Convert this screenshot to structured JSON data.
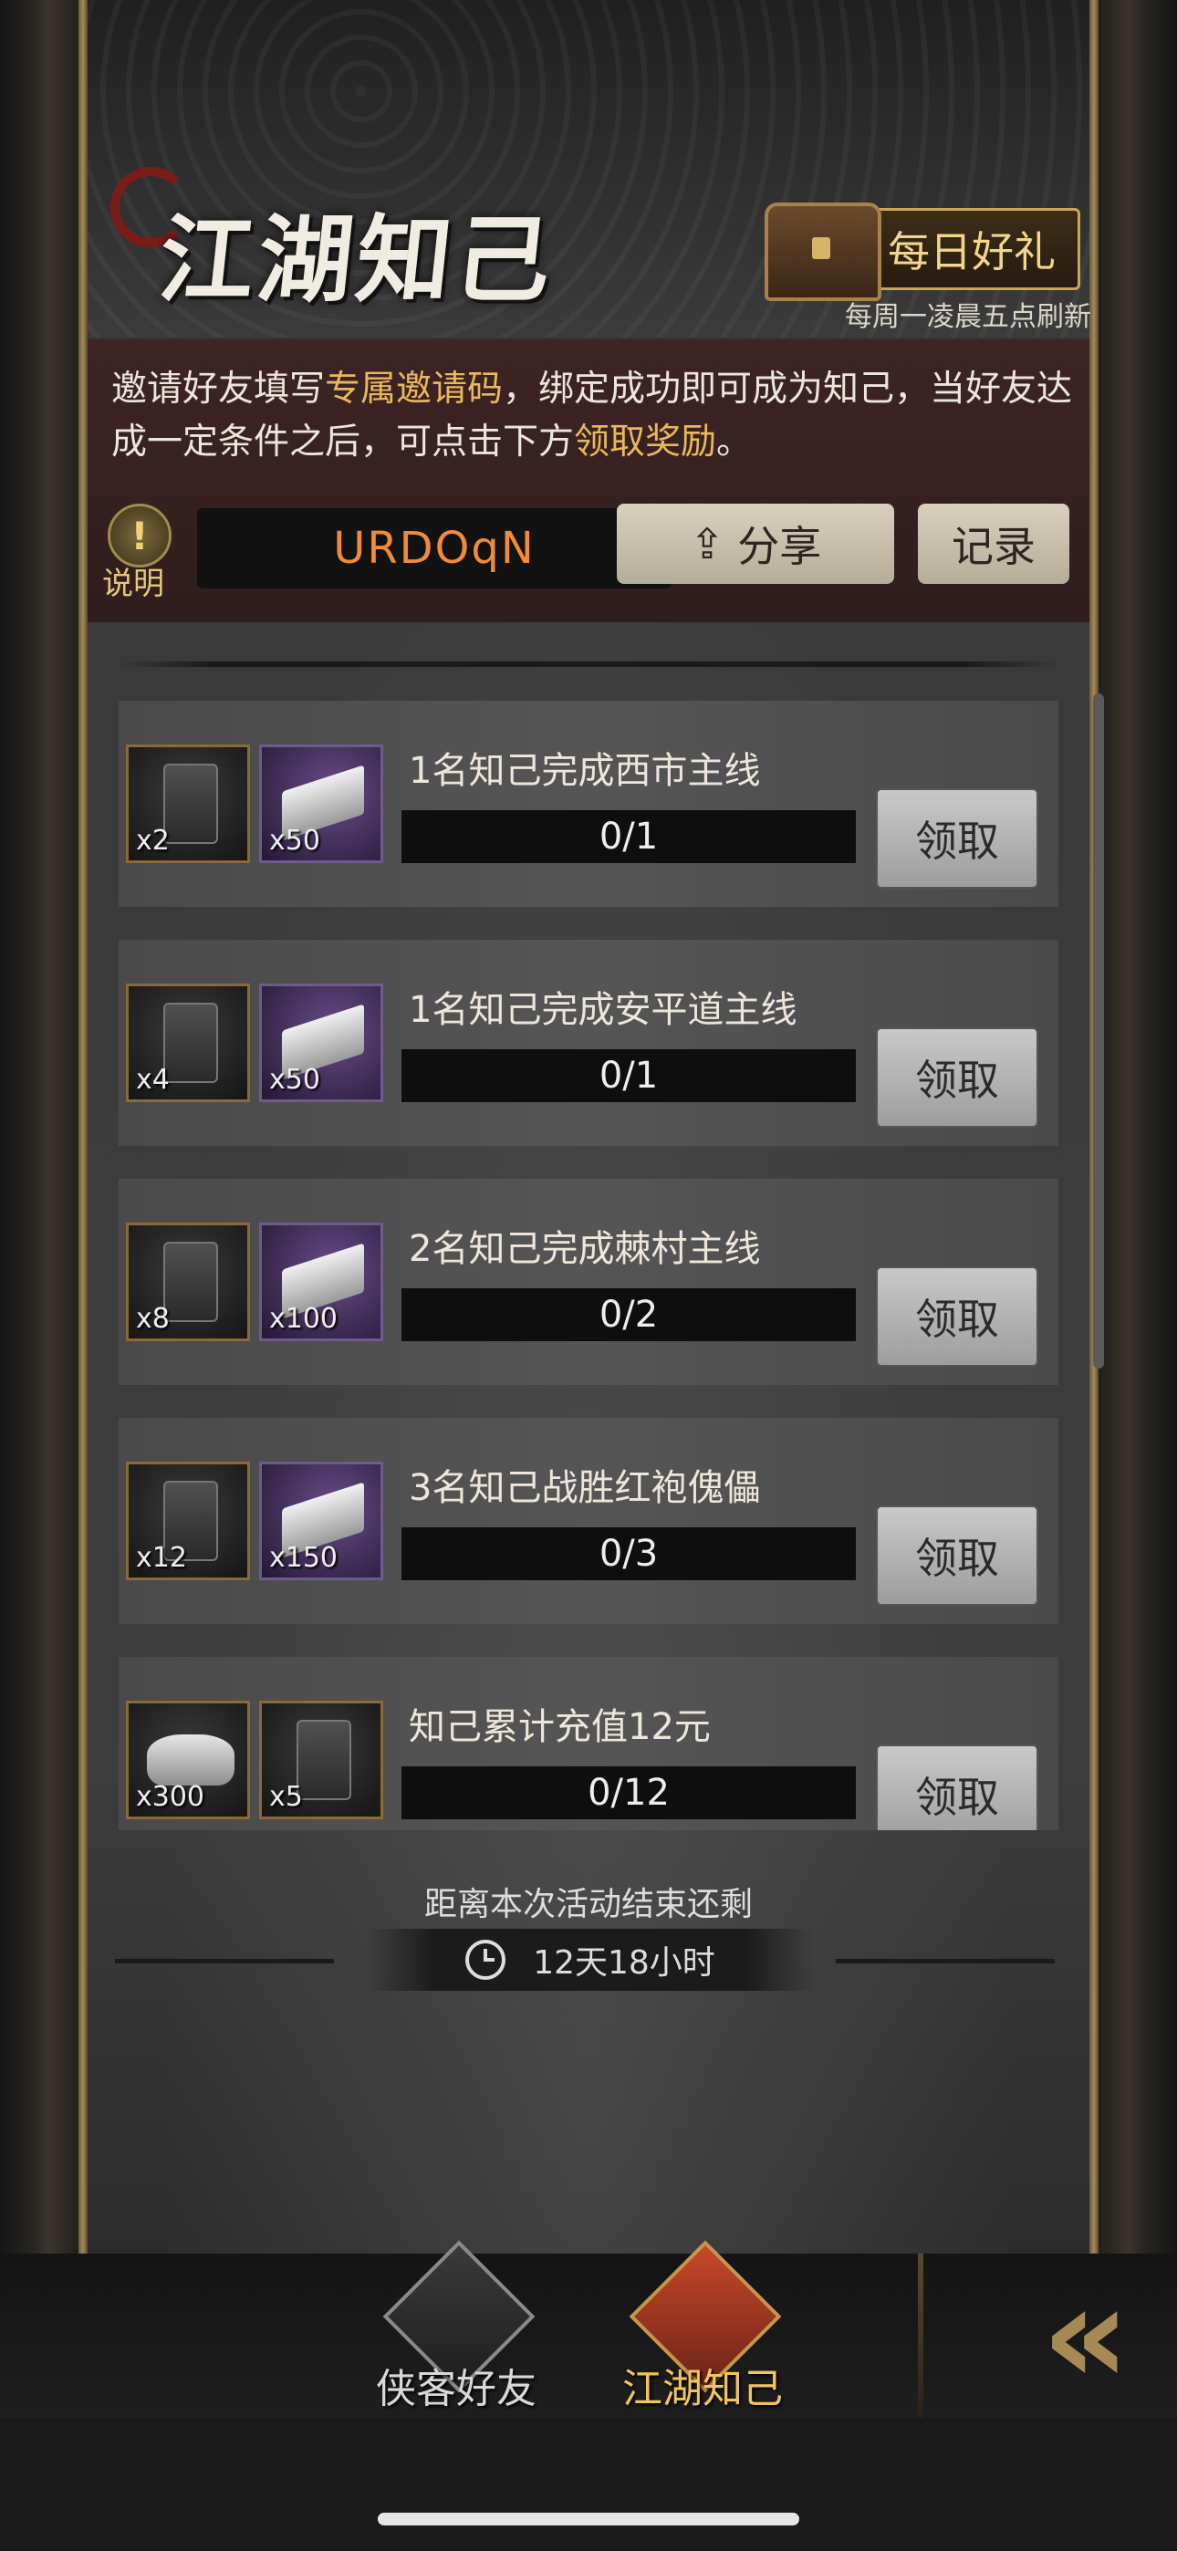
{
  "header": {
    "title": "江湖知己",
    "daily_gift": "每日好礼",
    "refresh_note": "每周一凌晨五点刷新"
  },
  "intro": {
    "part1": "邀请好友填写",
    "hl1": "专属邀请码",
    "part2": "，绑定成功即可成为知己，当好友达成一定条件之后，可点击下方",
    "hl2": "领取奖励",
    "part3": "。",
    "help_label": "说明",
    "invite_code": "URDOqN",
    "share_label": "分享",
    "record_label": "记录"
  },
  "tasks": [
    {
      "name": "1名知己完成西市主线",
      "progress": "0/1",
      "claim": "领取",
      "rewards": [
        {
          "qty": "x2"
        },
        {
          "qty": "x50"
        }
      ]
    },
    {
      "name": "1名知己完成安平道主线",
      "progress": "0/1",
      "claim": "领取",
      "rewards": [
        {
          "qty": "x4"
        },
        {
          "qty": "x50"
        }
      ]
    },
    {
      "name": "2名知己完成棘村主线",
      "progress": "0/2",
      "claim": "领取",
      "rewards": [
        {
          "qty": "x8"
        },
        {
          "qty": "x100"
        }
      ]
    },
    {
      "name": "3名知己战胜红袍傀儡",
      "progress": "0/3",
      "claim": "领取",
      "rewards": [
        {
          "qty": "x12"
        },
        {
          "qty": "x150"
        }
      ]
    },
    {
      "name": "知己累计充值12元",
      "progress": "0/12",
      "claim": "领取",
      "rewards": [
        {
          "qty": "x300"
        },
        {
          "qty": "x5"
        }
      ]
    }
  ],
  "timer": {
    "label": "距离本次活动结束还剩",
    "value": "12天18小时"
  },
  "nav": {
    "tab1": "侠客好友",
    "tab2": "江湖知己",
    "back_glyph": "«"
  },
  "colors": {
    "accent_gold": "#e9b85a",
    "code_orange": "#f18a3a",
    "intro_bg": "#3e2424"
  }
}
